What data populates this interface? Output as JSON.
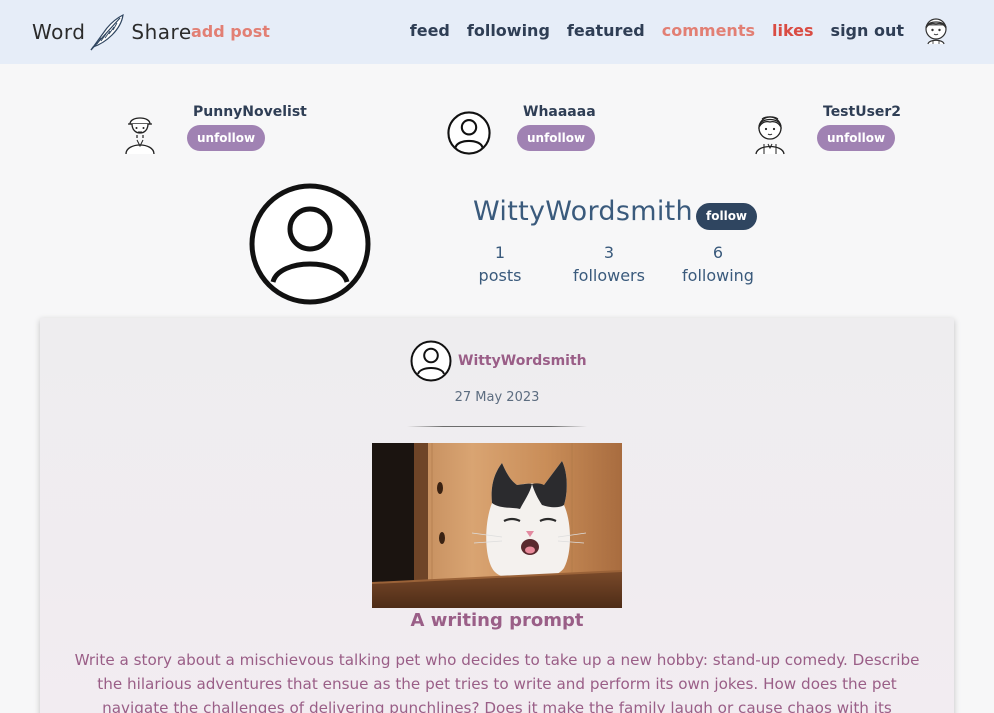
{
  "nav": {
    "brand_word": "Word",
    "brand_share": "Share",
    "add_post": "add post",
    "links": {
      "feed": "feed",
      "following": "following",
      "featured": "featured",
      "comments": "comments",
      "likes": "likes",
      "sign_out": "sign out"
    },
    "avatar_icon": "girl-avatar-icon"
  },
  "following_list": [
    {
      "name": "PunnyNovelist",
      "button": "unfollow",
      "icon": "man-cap-avatar-icon"
    },
    {
      "name": "Whaaaaa",
      "button": "unfollow",
      "icon": "default-user-icon"
    },
    {
      "name": "TestUser2",
      "button": "unfollow",
      "icon": "girl-avatar-icon"
    }
  ],
  "profile": {
    "username": "WittyWordsmith",
    "follow_button": "follow",
    "stats": {
      "posts": {
        "value": "1",
        "label": "posts"
      },
      "followers": {
        "value": "3",
        "label": "followers"
      },
      "following": {
        "value": "6",
        "label": "following"
      }
    }
  },
  "post": {
    "author": "WittyWordsmith",
    "date": "27 May 2023",
    "image_alt": "cat-photo",
    "title": "A writing prompt",
    "body": "Write a story about a mischievous talking pet who decides to take up a new hobby: stand-up comedy. Describe the hilarious adventures that ensue as the pet tries to write and perform its own jokes. How does the pet navigate the challenges of delivering punchlines? Does it make the family laugh or cause chaos with its comedic"
  },
  "colors": {
    "navbar_bg": "#e6edf8",
    "accent_coral": "#e27f74",
    "accent_red": "#d94c43",
    "navy": "#2f3e55",
    "purple_button": "#a082b3",
    "post_text": "#9a5e87"
  }
}
